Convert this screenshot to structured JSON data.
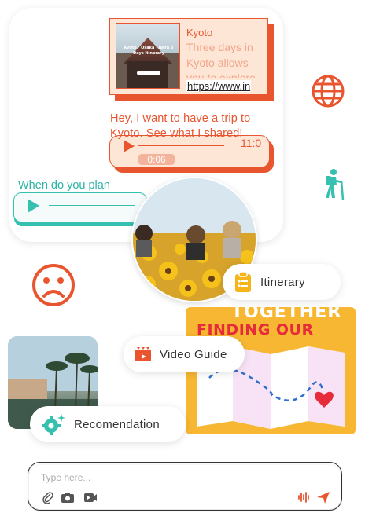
{
  "link_preview": {
    "title": "Kyoto",
    "description": "Three days in Kyoto allows you to explore",
    "url": "https://www.in",
    "thumbnail_caption": "Kyoto · Osaka · Nara 3 Days Itinerary"
  },
  "outgoing_message": {
    "text": "Hey, I want to have a trip to Kyoto. See what I shared!",
    "voice_time": "11:0",
    "voice_duration": "0:06"
  },
  "incoming_message": {
    "text": "When do you plan"
  },
  "features": {
    "itinerary_label": "Itinerary",
    "video_guide_label": "Video Guide",
    "recommendation_label": "Recomendation"
  },
  "poster": {
    "top_text": "TOGETHER",
    "title": "FINDING OUR WAY"
  },
  "composer": {
    "placeholder": "Type here..."
  },
  "colors": {
    "accent_orange": "#e8552f",
    "accent_teal": "#35c0b0",
    "poster_yellow": "#f8b732",
    "itinerary_icon": "#f5b51b",
    "video_icon": "#e8552f",
    "recommend_icon": "#35c0b0"
  },
  "icons": [
    "globe-icon",
    "hiker-icon",
    "sad-face-icon",
    "clipboard-icon",
    "film-icon",
    "gear-sparkle-icon",
    "paperclip-icon",
    "camera-icon",
    "video-camera-icon",
    "microphone-wave-icon",
    "send-icon",
    "play-icon"
  ]
}
